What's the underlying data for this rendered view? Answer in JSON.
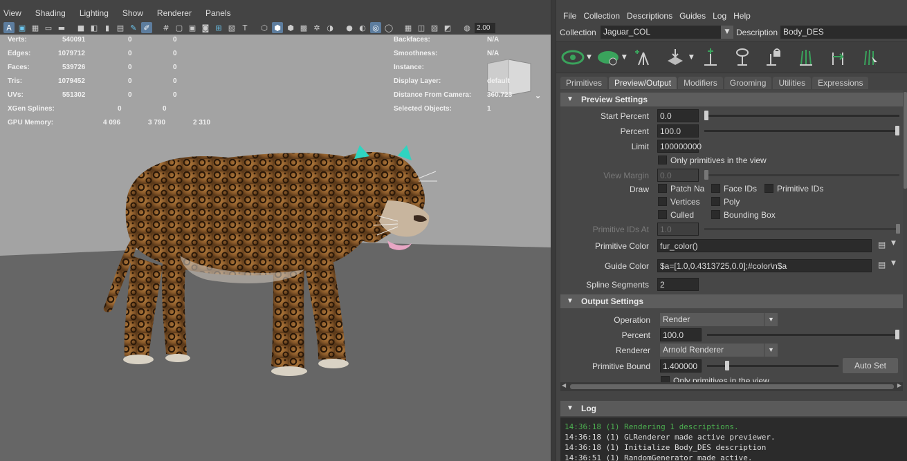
{
  "viewport": {
    "menu": [
      "View",
      "Shading",
      "Lighting",
      "Show",
      "Renderer",
      "Panels"
    ],
    "toolbar": {
      "value_field": "2.00"
    },
    "hud_left": [
      {
        "label": "Verts:",
        "v1": "540091",
        "v2": "0",
        "v3": "0"
      },
      {
        "label": "Edges:",
        "v1": "1079712",
        "v2": "0",
        "v3": "0"
      },
      {
        "label": "Faces:",
        "v1": "539726",
        "v2": "0",
        "v3": "0"
      },
      {
        "label": "Tris:",
        "v1": "1079452",
        "v2": "0",
        "v3": "0"
      },
      {
        "label": "UVs:",
        "v1": "551302",
        "v2": "0",
        "v3": "0"
      },
      {
        "label": "XGen Splines:",
        "v1": "",
        "v2": "0",
        "v3": "0"
      },
      {
        "label": "GPU Memory:",
        "v1": "4 096",
        "v2": "3 790",
        "v3": "2 310"
      }
    ],
    "hud_right": [
      {
        "label": "Backfaces:",
        "value": "N/A"
      },
      {
        "label": "Smoothness:",
        "value": "N/A"
      },
      {
        "label": "Instance:",
        "value": ""
      },
      {
        "label": "Display Layer:",
        "value": "default"
      },
      {
        "label": "Distance From Camera:",
        "value": "360.723"
      },
      {
        "label": "Selected Objects:",
        "value": "1"
      }
    ]
  },
  "xgen": {
    "menu": [
      "File",
      "Collection",
      "Descriptions",
      "Guides",
      "Log",
      "Help"
    ],
    "collection_label": "Collection",
    "collection_value": "Jaguar_COL",
    "description_label": "Description",
    "description_value": "Body_DES",
    "toolbar_icons": [
      "visibility-eye-icon",
      "hide-leaf-icon",
      "add-guide-icon",
      "move-guide-icon",
      "add-primitive-icon",
      "guide-visibility-icon",
      "lock-guide-icon",
      "sculpt-guides-icon",
      "flip-guides-icon",
      "select-guides-icon"
    ],
    "tabs": [
      "Primitives",
      "Preview/Output",
      "Modifiers",
      "Grooming",
      "Utilities",
      "Expressions"
    ],
    "active_tab": "Preview/Output",
    "preview_settings": {
      "title": "Preview Settings",
      "start_percent_label": "Start Percent",
      "start_percent": "0.0",
      "start_percent_level": 0.0,
      "percent_label": "Percent",
      "percent": "100.0",
      "percent_level": 1.0,
      "limit_label": "Limit",
      "limit": "100000000",
      "only_primitives": "Only primitives in the view",
      "view_margin_label": "View Margin",
      "view_margin": "0.0",
      "draw_label": "Draw",
      "draw_options": [
        "Patch Na",
        "Face IDs",
        "Primitive IDs",
        "Vertices",
        "Poly",
        "Culled",
        "Bounding Box"
      ],
      "primitive_ids_at_label": "Primitive IDs At",
      "primitive_ids_at": "1.0",
      "primitive_color_label": "Primitive Color",
      "primitive_color": "fur_color()",
      "guide_color_label": "Guide Color",
      "guide_color": "$a=[1.0,0.4313725,0.0];#color\\n$a",
      "spline_segments_label": "Spline Segments",
      "spline_segments": "2"
    },
    "output_settings": {
      "title": "Output Settings",
      "operation_label": "Operation",
      "operation": "Render",
      "percent_label": "Percent",
      "percent": "100.0",
      "percent_level": 1.0,
      "renderer_label": "Renderer",
      "renderer": "Arnold Renderer",
      "primitive_bound_label": "Primitive Bound",
      "primitive_bound": "1.400000",
      "primitive_bound_level": 0.14,
      "auto_set": "Auto Set",
      "only_primitives": "Only primitives in the view"
    },
    "log": {
      "title": "Log",
      "lines": [
        "14:36:18 (1) Rendering 1 descriptions.",
        "14:36:18 (1) GLRenderer made active previewer.",
        "14:36:18 (1) Initialize Body_DES description",
        "14:36:51 (1) RandomGenerator made active."
      ]
    }
  },
  "colors": {
    "panel_bg": "#444444",
    "field_bg": "#2b2b2b",
    "scene_sky": "#a3a3a3",
    "scene_floor": "#666666",
    "active_blue": "#5d7d9e",
    "log_green": "#4caf50",
    "icon_green": "#3aa35c"
  }
}
